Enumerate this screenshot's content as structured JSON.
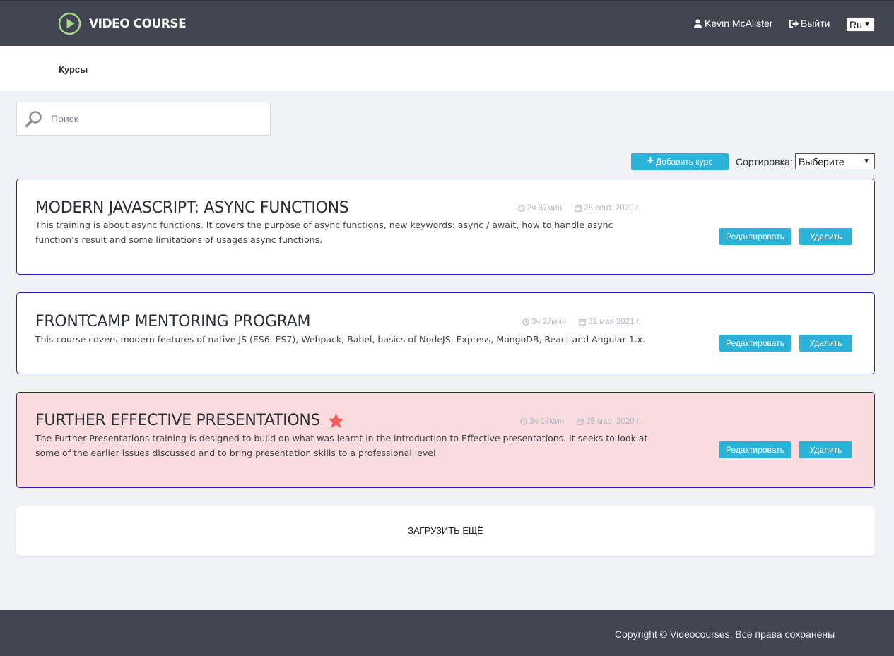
{
  "header": {
    "logo_text": "VIDEO COURSE",
    "logo_color": "#a8d88a",
    "user_name": "Kevin McAlister",
    "logout_label": "Выйти",
    "language": "Ru"
  },
  "breadcrumb": "Курсы",
  "search": {
    "placeholder": "Поиск"
  },
  "toolbar": {
    "add_label": "Добавить курс",
    "sort_label": "Сортировка:",
    "sort_value": "Выберите"
  },
  "courses": [
    {
      "title": "MODERN JAVASCRIPT: ASYNC FUNCTIONS",
      "duration": "2ч 37мин",
      "date": "28 сент. 2020 г.",
      "description": "This training is about async functions. It covers the purpose of async functions, new keywords: async / await, how to handle async function’s result and some limitations of usages async functions.",
      "starred": false,
      "edit_label": "Редактировать",
      "delete_label": "Удалить"
    },
    {
      "title": "FRONTCAMP MENTORING PROGRAM",
      "duration": "3ч 27мин",
      "date": "31 мая 2021 г.",
      "description": "This course covers modern features of native JS (ES6, ES7), Webpack, Babel, basics of NodeJS, Express, MongoDB, React and Angular 1.x.",
      "starred": false,
      "edit_label": "Редактировать",
      "delete_label": "Удалить"
    },
    {
      "title": "FURTHER EFFECTIVE PRESENTATIONS",
      "duration": "3ч 17мин",
      "date": "25 мар. 2020 г.",
      "description": "The Further Presentations training is designed to build on what was learnt in the introduction to Effective presentations. It seeks to look at some of the earlier issues discussed and to bring presentation skills to a professional level.",
      "starred": true,
      "edit_label": "Редактировать",
      "delete_label": "Удалить"
    }
  ],
  "load_more": "ЗАГРУЗИТЬ ЕЩЁ",
  "footer": {
    "copyright": "Copyright © Videocourses. Все права сохранены"
  },
  "colors": {
    "header_bg": "#414550",
    "accent": "#2ab2d9",
    "card_border": "#2222cc",
    "starred_bg": "#fbdcde",
    "star": "#f25c5c"
  }
}
